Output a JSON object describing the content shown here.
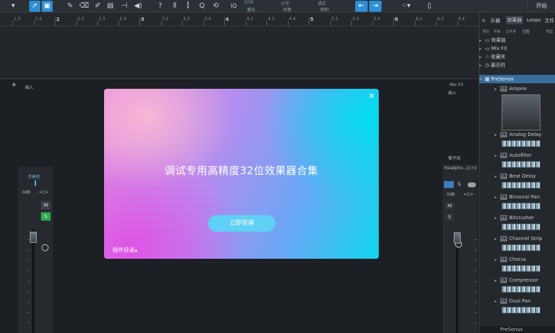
{
  "toolbar": {
    "quantize_value": "1/16",
    "quantize_label": "量化",
    "timebase_value": "小节",
    "timebase_label": "时基",
    "snap_value": "适应",
    "snap_label": "吸附",
    "iq_label": "IQ",
    "start_label": "开始"
  },
  "ruler": {
    "labels": [
      "1.3",
      "1.4",
      "2",
      "2.2",
      "2.3",
      "2.4",
      "3",
      "3.2",
      "3.3",
      "3.4",
      "4",
      "4.2",
      "4.3",
      "4.4",
      "5",
      "5.2",
      "5.3",
      "5.4",
      "6",
      "6.2",
      "6.3",
      "6.4"
    ]
  },
  "console": {
    "insert_label_left": "插入",
    "channel_name": "手摔的",
    "db_left": "0dB",
    "pan_left": "<C>",
    "mute_label": "M",
    "solo_label": "S",
    "mixfx_label": "Mix FX",
    "insert_label_right": "插入",
    "post_label": "推子后",
    "output_name": "Headpho...|1+2",
    "db_right": "0dB",
    "pan_right": "<C>",
    "add_icon": "+"
  },
  "browser": {
    "tabs": [
      "乐器",
      "效果器",
      "Loops",
      "文件"
    ],
    "active_tab": "效果器",
    "subtabs": [
      "类别",
      "平铺",
      "文件夹",
      "厂商",
      "类型"
    ],
    "folders": [
      {
        "label": "效果链",
        "icon": "folder-icon"
      },
      {
        "label": "Mix FX",
        "icon": "folder-icon"
      },
      {
        "label": "收藏夹",
        "icon": "star-icon"
      },
      {
        "label": "最近的",
        "icon": "clock-icon"
      }
    ],
    "vendor": "PreSonus",
    "plugins": [
      "Ampire",
      "Analog Delay",
      "Autofilter",
      "Beat Delay",
      "Binaural Pan",
      "Bitcrusher",
      "Channel Strip",
      "Chorus",
      "Compressor",
      "Dual Pan"
    ],
    "fx_tag": "FX",
    "footer_label": "PreSonus"
  },
  "dialog": {
    "title": "调试专用高精度32位效果器合集",
    "install_label": "立即安装",
    "plugin_dir_label": "插件目录▴",
    "close_label": "✕",
    "colors": {
      "pink": "#e88cdd",
      "magenta": "#e050e6",
      "cyan": "#0fd6ee",
      "button": "#5fd0f6"
    }
  }
}
